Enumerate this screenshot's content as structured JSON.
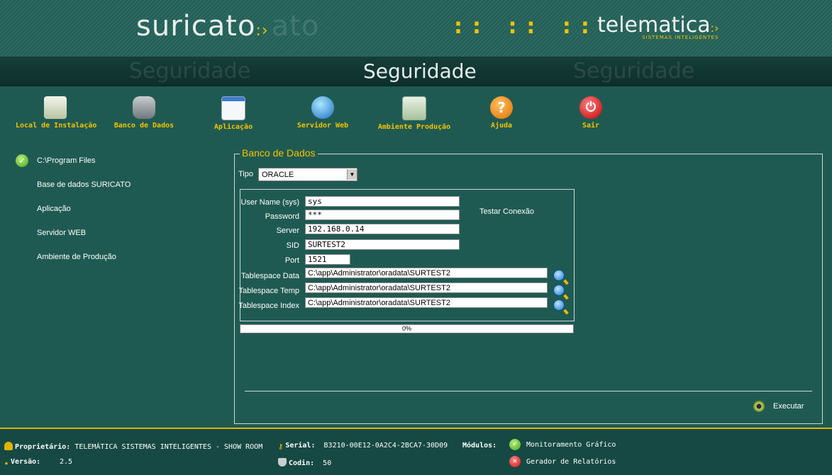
{
  "brand": {
    "left": "suricato",
    "left_ghost": "ato",
    "arrows": ":: :: ::",
    "right": "telematica",
    "right_tagline": "SISTEMAS INTELIGENTES"
  },
  "page": {
    "title": "Seguridade",
    "ghost_left": "Seguridade",
    "ghost_right": "Seguridade"
  },
  "toolbar": [
    {
      "label": "Local de Instalação",
      "icon": "disk-icon",
      "color": "#d9e2c8"
    },
    {
      "label": "Banco de Dados",
      "icon": "database-icon",
      "color": "#9aa3a8"
    },
    {
      "label": "Aplicação",
      "icon": "app-window-icon",
      "color": "#e8f0f0"
    },
    {
      "label": "Servidor Web",
      "icon": "globe-icon",
      "color": "#3b8fd6"
    },
    {
      "label": "Ambiente Produção",
      "icon": "gear-window-icon",
      "color": "#cfe0c8"
    },
    {
      "label": "Ajuda",
      "icon": "help-icon",
      "color": "#f08a00"
    },
    {
      "label": "Sair",
      "icon": "power-icon",
      "color": "#e02020"
    }
  ],
  "nav": [
    {
      "label": "C:\\Program Files",
      "checked": true
    },
    {
      "label": "Base de dados SURICATO",
      "checked": false
    },
    {
      "label": "Aplicação",
      "checked": false
    },
    {
      "label": "Servidor WEB",
      "checked": false
    },
    {
      "label": "Ambiente de Produção",
      "checked": false
    }
  ],
  "panel": {
    "legend": "Banco de Dados",
    "tipo_label": "Tipo",
    "tipo_value": "ORACLE",
    "test_connection": "Testar Conexão",
    "fields": {
      "user_label": "User Name (sys)",
      "user_value": "sys",
      "password_label": "Password",
      "password_value": "***",
      "server_label": "Server",
      "server_value": "192.168.0.14",
      "sid_label": "SID",
      "sid_value": "SURTEST2",
      "port_label": "Port",
      "port_value": "1521",
      "ts_data_label": "Tablespace Data",
      "ts_data_value": "C:\\app\\Administrator\\oradata\\SURTEST2",
      "ts_temp_label": "Tablespace Temp",
      "ts_temp_value": "C:\\app\\Administrator\\oradata\\SURTEST2",
      "ts_index_label": "Tablespace Index",
      "ts_index_value": "C:\\app\\Administrator\\oradata\\SURTEST2"
    },
    "progress_text": "0%",
    "progress_fraction": 0,
    "execute_label": "Executar"
  },
  "footer": {
    "owner_label": "Proprietário:",
    "owner_value": "TELEMÁTICA SISTEMAS INTELIGENTES - SHOW ROOM",
    "version_label": "Versão:",
    "version_value": "2.5",
    "serial_label": "Serial:",
    "serial_value": "B3210-00E12-0A2C4-2BCA7-30D09",
    "codin_label": "Codin:",
    "codin_value": "50",
    "modules_label": "Módulos:",
    "module_1": "Monitoramento Gráfico",
    "module_2": "Gerador de Relatórios"
  },
  "colors": {
    "background": "#1f5a52",
    "accent": "#f3c400",
    "banner": "#2c6b62"
  }
}
